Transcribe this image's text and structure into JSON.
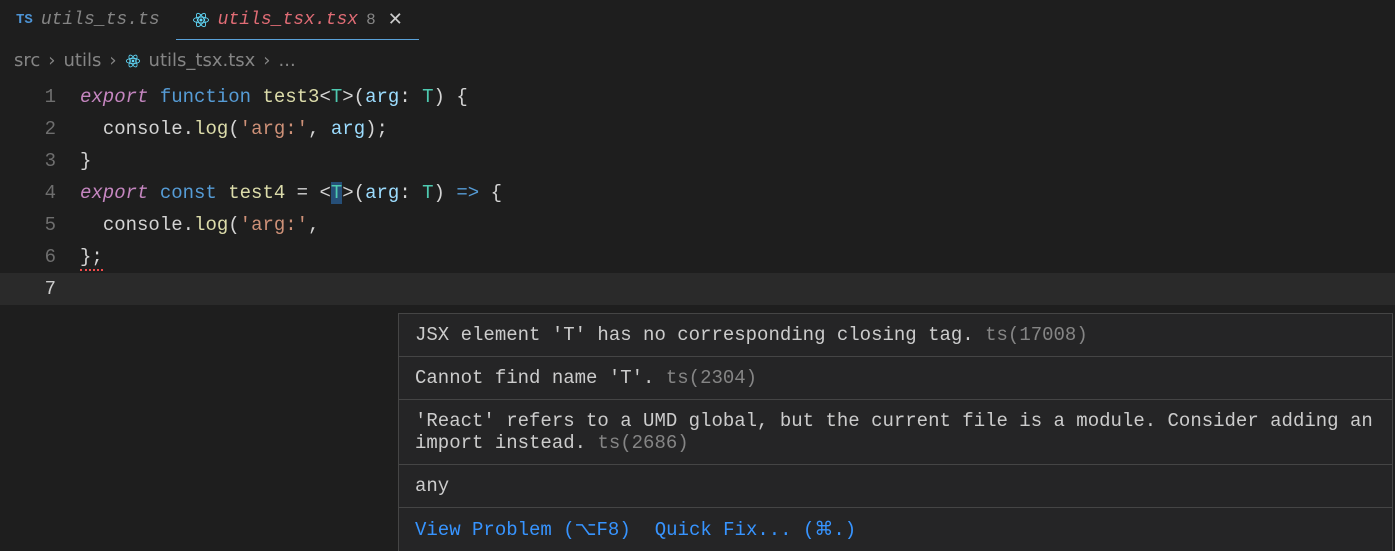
{
  "tabs": [
    {
      "label": "utils_ts.ts",
      "icon": "TS"
    },
    {
      "label": "utils_tsx.tsx",
      "icon": "react",
      "badge": "8",
      "active": true,
      "closable": true
    }
  ],
  "breadcrumb": {
    "parts": [
      "src",
      "utils",
      "utils_tsx.tsx",
      "..."
    ],
    "fileIcon": "react"
  },
  "code": {
    "lines": {
      "1": {
        "tokens": [
          {
            "cls": "kw-export",
            "t": "export"
          },
          {
            "cls": "punct",
            "t": " "
          },
          {
            "cls": "kw-function",
            "t": "function"
          },
          {
            "cls": "punct",
            "t": " "
          },
          {
            "cls": "fn-name",
            "t": "test3"
          },
          {
            "cls": "punct",
            "t": "<"
          },
          {
            "cls": "type",
            "t": "T"
          },
          {
            "cls": "punct",
            "t": ">("
          },
          {
            "cls": "param",
            "t": "arg"
          },
          {
            "cls": "punct",
            "t": ": "
          },
          {
            "cls": "type",
            "t": "T"
          },
          {
            "cls": "punct",
            "t": ") {"
          }
        ]
      },
      "2": {
        "indent": "  ",
        "tokens": [
          {
            "cls": "obj",
            "t": "console"
          },
          {
            "cls": "punct",
            "t": "."
          },
          {
            "cls": "method",
            "t": "log"
          },
          {
            "cls": "punct",
            "t": "("
          },
          {
            "cls": "string",
            "t": "'arg:'"
          },
          {
            "cls": "punct",
            "t": ", "
          },
          {
            "cls": "param",
            "t": "arg"
          },
          {
            "cls": "punct",
            "t": ");"
          }
        ]
      },
      "3": {
        "tokens": [
          {
            "cls": "punct",
            "t": "}"
          }
        ]
      },
      "4": {
        "tokens": [
          {
            "cls": "kw-export",
            "t": "export"
          },
          {
            "cls": "punct",
            "t": " "
          },
          {
            "cls": "kw-const",
            "t": "const"
          },
          {
            "cls": "punct",
            "t": " "
          },
          {
            "cls": "fn-name",
            "t": "test4"
          },
          {
            "cls": "punct",
            "t": " = "
          },
          {
            "cls": "punct",
            "t": "<"
          },
          {
            "cls": "type cursor-highlight",
            "t": "T"
          },
          {
            "cls": "punct",
            "t": ">("
          },
          {
            "cls": "param",
            "t": "arg"
          },
          {
            "cls": "punct",
            "t": ": "
          },
          {
            "cls": "type",
            "t": "T"
          },
          {
            "cls": "punct",
            "t": ") "
          },
          {
            "cls": "op",
            "t": "=>"
          },
          {
            "cls": "punct",
            "t": " {"
          }
        ]
      },
      "5": {
        "indent": "  ",
        "tokens": [
          {
            "cls": "obj",
            "t": "console"
          },
          {
            "cls": "punct",
            "t": "."
          },
          {
            "cls": "method",
            "t": "log"
          },
          {
            "cls": "punct",
            "t": "("
          },
          {
            "cls": "string",
            "t": "'arg:'"
          },
          {
            "cls": "punct",
            "t": ","
          }
        ]
      },
      "6": {
        "tokens": [
          {
            "cls": "punct squiggle-red",
            "t": "};"
          }
        ]
      },
      "7": {
        "tokens": []
      }
    }
  },
  "hover": {
    "errors": [
      {
        "msg": "JSX element 'T' has no corresponding closing tag.",
        "code": "ts(17008)"
      },
      {
        "msg": "Cannot find name 'T'.",
        "code": "ts(2304)"
      },
      {
        "msg": "'React' refers to a UMD global, but the current file is a module. Consider adding an import instead.",
        "code": "ts(2686)"
      }
    ],
    "type": "any",
    "actions": {
      "viewProblem": "View Problem (⌥F8)",
      "quickFix": "Quick Fix... (⌘.)"
    }
  }
}
